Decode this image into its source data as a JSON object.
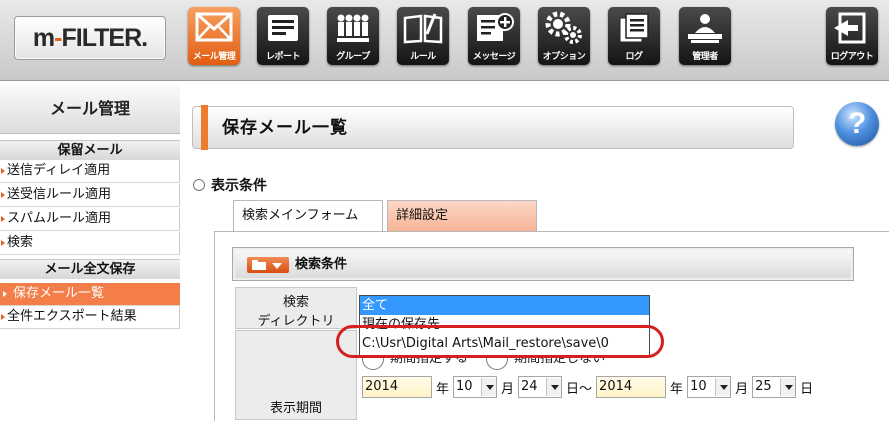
{
  "app": {
    "logo_main": "m",
    "logo_dash": "-",
    "logo_rest": "FILTER."
  },
  "nav": [
    {
      "label": "メール管理",
      "icon": "envelope-icon",
      "active": true
    },
    {
      "label": "レポート",
      "icon": "report-icon"
    },
    {
      "label": "グループ",
      "icon": "group-icon"
    },
    {
      "label": "ルール",
      "icon": "rule-book-icon"
    },
    {
      "label": "メッセージ",
      "icon": "message-add-icon"
    },
    {
      "label": "オプション",
      "icon": "gears-icon"
    },
    {
      "label": "ログ",
      "icon": "log-icon"
    },
    {
      "label": "管理者",
      "icon": "admin-icon"
    },
    {
      "label": "ログアウト",
      "icon": "logout-icon"
    }
  ],
  "sidebar": {
    "title": "メール管理",
    "section1": "保留メール",
    "items1": [
      "送信ディレイ適用",
      "送受信ルール適用",
      "スパムルール適用",
      "検索"
    ],
    "section2": "メール全文保存",
    "items2": [
      "保存メール一覧",
      "全件エクスポート結果"
    ]
  },
  "main": {
    "page_title": "保存メール一覧",
    "help": "?",
    "cond_radio_label": "表示条件",
    "tabs": [
      "検索メインフォーム",
      "詳細設定"
    ],
    "cond_header": "検索条件",
    "row_dir_label_1": "検索",
    "row_dir_label_2": "ディレクトリ",
    "row_period_label": "表示期間",
    "period_opt1": "期間指定する",
    "period_opt2": "期間指定しない",
    "dropdown_options": [
      "全て",
      "現在の保存先",
      "C:\\Usr\\Digital Arts\\Mail_restore\\save\\0"
    ],
    "date": {
      "from_year": "2014",
      "from_month": "10",
      "from_day": "24",
      "to_year": "2014",
      "to_month": "10",
      "to_day": "25",
      "unit_year": "年",
      "unit_month": "月",
      "unit_day_tilde": "日〜",
      "unit_day": "日"
    }
  },
  "colors": {
    "accent": "#e25d12",
    "selected": "#3399ff",
    "highlight": "#d42020"
  }
}
